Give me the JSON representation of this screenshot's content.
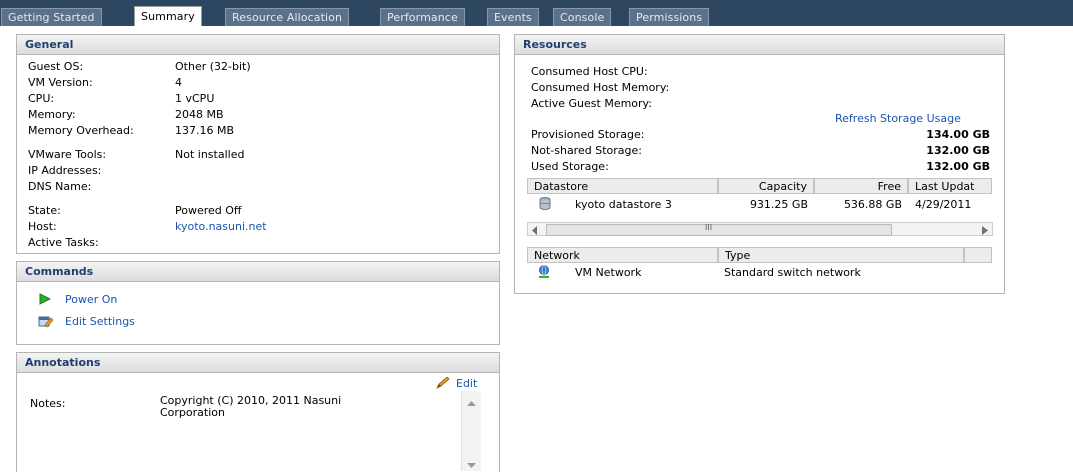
{
  "tabs": [
    {
      "label": "Getting Started"
    },
    {
      "label": "Summary"
    },
    {
      "label": "Resource Allocation"
    },
    {
      "label": "Performance"
    },
    {
      "label": "Events"
    },
    {
      "label": "Console"
    },
    {
      "label": "Permissions"
    }
  ],
  "general": {
    "title": "General",
    "guest_os_label": "Guest OS:",
    "guest_os": "Other (32-bit)",
    "vm_version_label": "VM Version:",
    "vm_version": "4",
    "cpu_label": "CPU:",
    "cpu": "1 vCPU",
    "memory_label": "Memory:",
    "memory": "2048 MB",
    "memory_overhead_label": "Memory Overhead:",
    "memory_overhead": "137.16 MB",
    "vmware_tools_label": "VMware Tools:",
    "vmware_tools": "Not installed",
    "ip_label": "IP Addresses:",
    "dns_label": "DNS Name:",
    "state_label": "State:",
    "state": "Powered Off",
    "host_label": "Host:",
    "host": "kyoto.nasuni.net",
    "active_tasks_label": "Active Tasks:"
  },
  "commands": {
    "title": "Commands",
    "power_on": "Power On",
    "edit_settings": "Edit Settings"
  },
  "annotations": {
    "title": "Annotations",
    "edit": "Edit",
    "notes_label": "Notes:",
    "notes_line1": "Copyright (C) 2010, 2011 Nasuni",
    "notes_line2": "Corporation"
  },
  "resources": {
    "title": "Resources",
    "consumed_cpu_label": "Consumed Host CPU:",
    "consumed_memory_label": "Consumed Host Memory:",
    "active_guest_memory_label": "Active Guest Memory:",
    "refresh_storage": "Refresh Storage Usage",
    "provisioned_label": "Provisioned Storage:",
    "provisioned": "134.00 GB",
    "not_shared_label": "Not-shared Storage:",
    "not_shared": "132.00 GB",
    "used_label": "Used Storage:",
    "used": "132.00 GB",
    "datastore_columns": [
      "Datastore",
      "Capacity",
      "Free",
      "Last Updat"
    ],
    "datastore_rows": [
      {
        "name": "kyoto datastore 3",
        "capacity": "931.25 GB",
        "free": "536.88 GB",
        "last_update": "4/29/2011"
      }
    ],
    "scroll_mark": "III",
    "network_columns": [
      "Network",
      "Type"
    ],
    "network_rows": [
      {
        "name": "VM Network",
        "type": "Standard switch network"
      }
    ]
  },
  "colors": {
    "tab_bar": "#2e4760",
    "header_text": "#1f3f6e",
    "link": "#1a55b0",
    "power_on_green": "#2fae2f"
  }
}
